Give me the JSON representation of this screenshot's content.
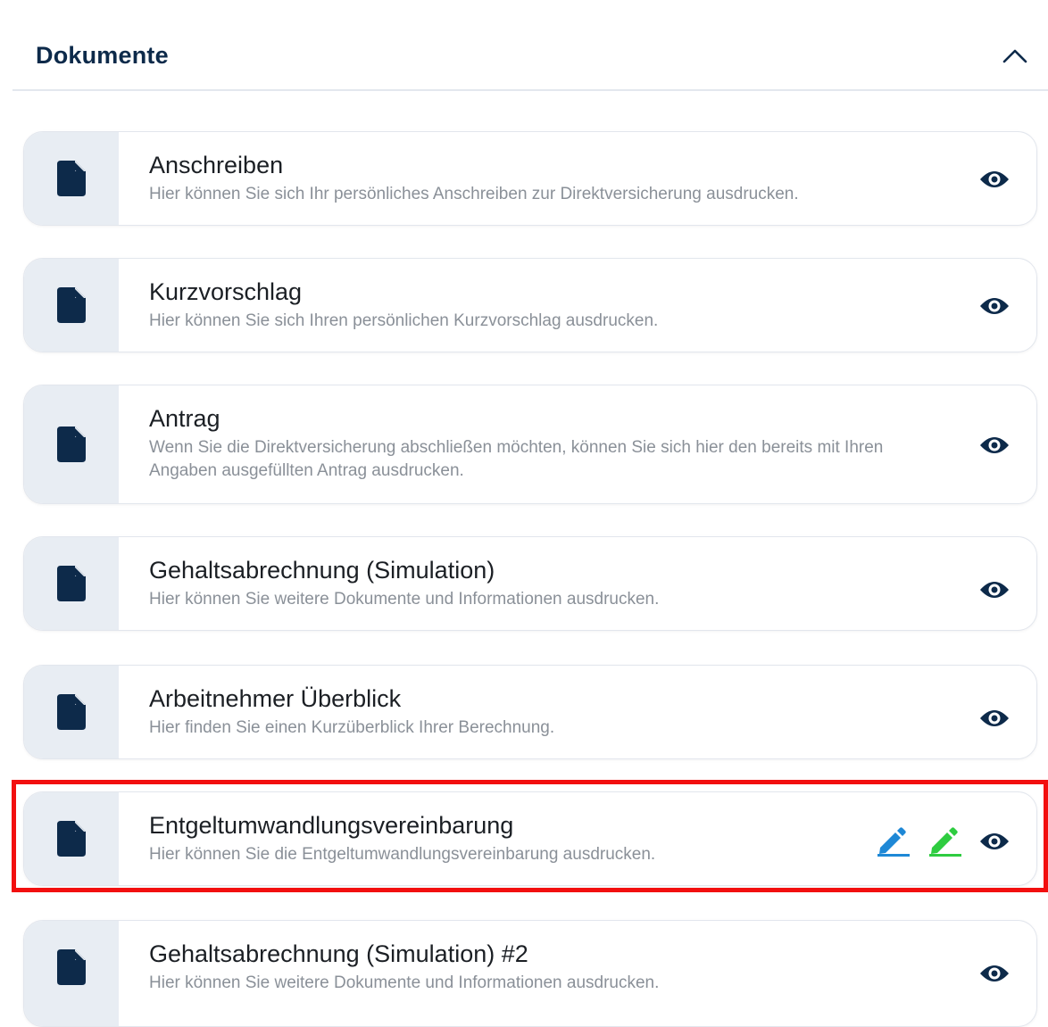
{
  "section": {
    "title": "Dokumente",
    "collapse_icon": "chevron-up-icon"
  },
  "documents": [
    {
      "title": "Anschreiben",
      "description": "Hier können Sie sich Ihr persönliches Anschreiben zur Direktversicherung ausdrucken.",
      "icon": "document-icon",
      "actions": [
        "view"
      ]
    },
    {
      "title": "Kurzvorschlag",
      "description": "Hier können Sie sich Ihren persönlichen Kurzvorschlag ausdrucken.",
      "icon": "document-icon",
      "actions": [
        "view"
      ]
    },
    {
      "title": "Antrag",
      "description": "Wenn Sie die Direktversicherung abschließen möchten, können Sie sich hier den bereits mit Ihren Angaben ausgefüllten Antrag ausdrucken.",
      "icon": "document-icon",
      "actions": [
        "view"
      ]
    },
    {
      "title": "Gehaltsabrechnung (Simulation)",
      "description": "Hier können Sie weitere Dokumente und Informationen ausdrucken.",
      "icon": "document-icon",
      "actions": [
        "view"
      ]
    },
    {
      "title": "Arbeitnehmer Überblick",
      "description": "Hier finden Sie einen Kurzüberblick Ihrer Berechnung.",
      "icon": "document-icon",
      "actions": [
        "view"
      ]
    },
    {
      "title": "Entgeltumwandlungsvereinbarung",
      "description": "Hier können Sie die Entgeltumwandlungsvereinbarung ausdrucken.",
      "icon": "document-icon",
      "actions": [
        "sign-blue",
        "sign-green",
        "view"
      ],
      "highlighted": true
    },
    {
      "title": "Gehaltsabrechnung (Simulation) #2",
      "description": "Hier können Sie weitere Dokumente und Informationen ausdrucken.",
      "icon": "document-icon",
      "actions": [
        "view"
      ]
    }
  ],
  "colors": {
    "heading": "#0d2a4a",
    "icon_dark": "#0d2a4a",
    "pen_blue": "#1e88d6",
    "pen_green": "#2ecc40",
    "highlight": "#f20f0f",
    "icon_bg": "#e8edf3"
  }
}
